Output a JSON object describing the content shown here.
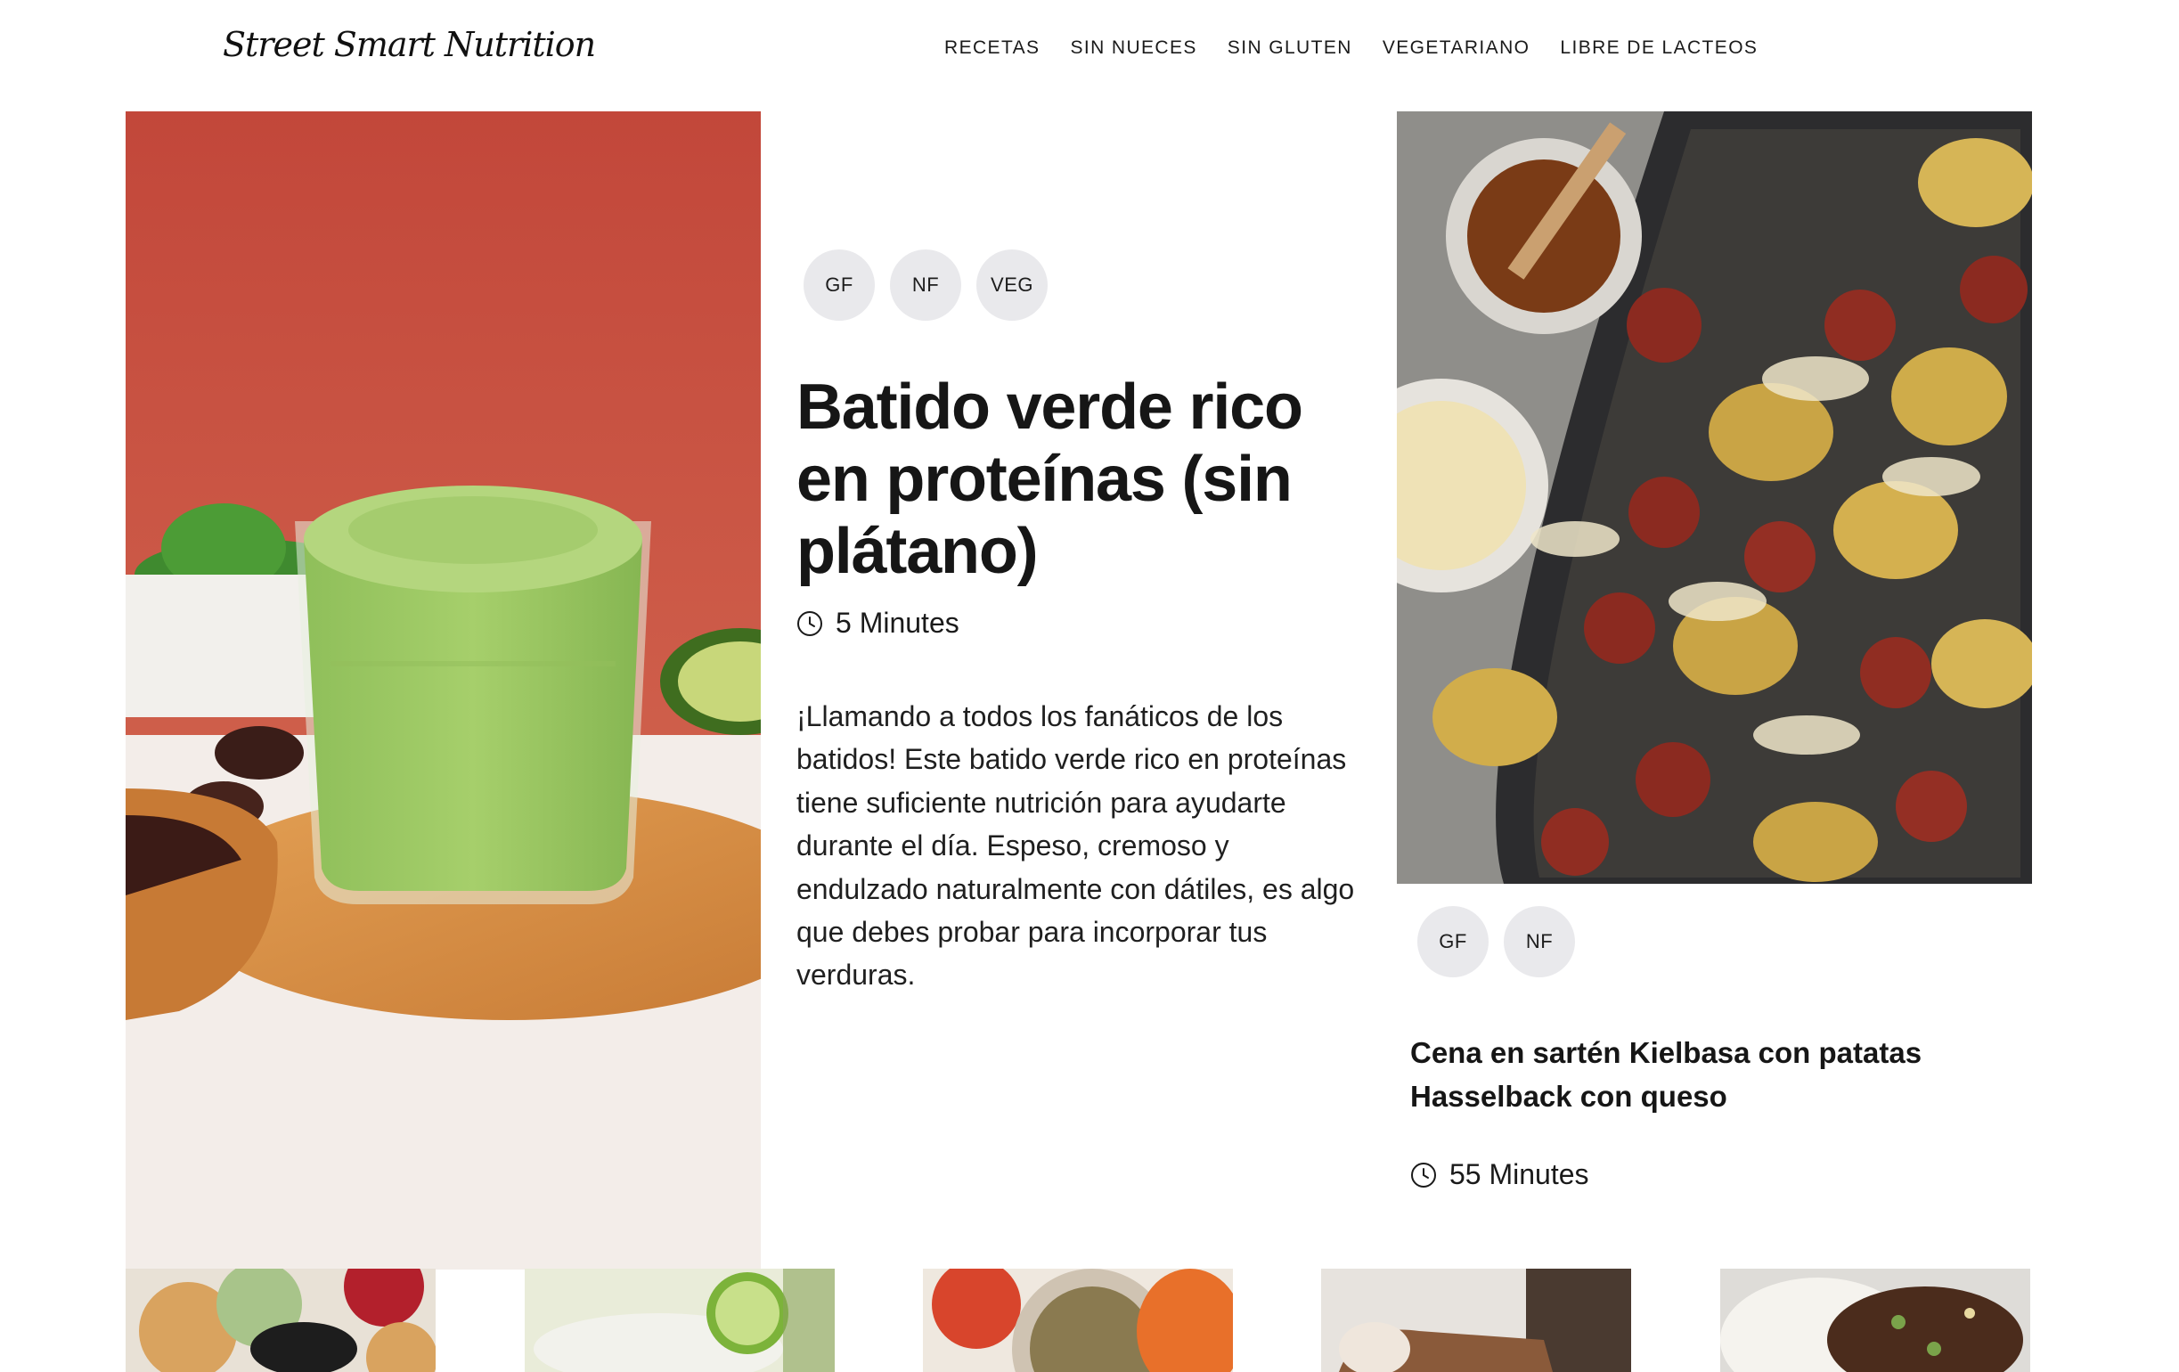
{
  "site": {
    "logo_text": "Street Smart Nutrition"
  },
  "nav": {
    "items": [
      {
        "label": "RECETAS"
      },
      {
        "label": "SIN NUECES"
      },
      {
        "label": "SIN GLUTEN"
      },
      {
        "label": "VEGETARIANO"
      },
      {
        "label": "LIBRE DE LACTEOS"
      }
    ]
  },
  "featured": {
    "badges": [
      "GF",
      "NF",
      "VEG"
    ],
    "title": "Batido verde rico en proteínas (sin plátano)",
    "time": "5 Minutes",
    "description": "¡Llamando a todos los fanáticos de los batidos! Este batido verde rico en proteínas tiene suficiente nutrición para ayudarte durante el día. Espeso, cremoso y endulzado naturalmente con dátiles, es algo que debes probar para incorporar tus verduras.",
    "image": "green-smoothie-photo"
  },
  "side_card": {
    "badges": [
      "GF",
      "NF"
    ],
    "title": "Cena en sartén Kielbasa con patatas Hasselback con queso",
    "time": "55 Minutes",
    "image": "kielbasa-sheet-pan-photo"
  },
  "bottom_row": [
    {
      "image": "charcuterie-photo"
    },
    {
      "image": "margarita-photo"
    },
    {
      "image": "yogurt-bowl-photo"
    },
    {
      "image": "chocolate-bar-photo"
    },
    {
      "image": "beef-rice-bowl-photo"
    }
  ],
  "icons": {
    "time": "clock-icon"
  },
  "colors": {
    "badge_bg": "#e9e9ec",
    "hero_backdrop": "#c24b3c",
    "text": "#1a1a1a"
  }
}
